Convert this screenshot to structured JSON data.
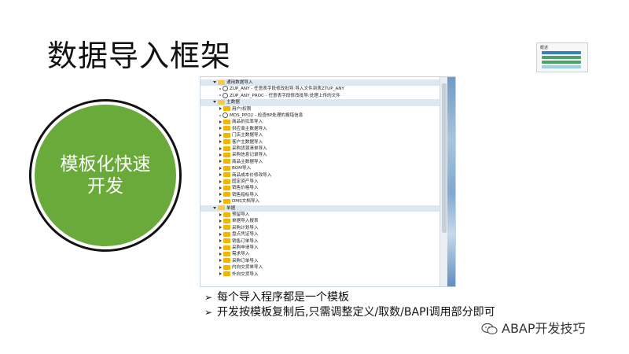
{
  "slide": {
    "title": "数据导入框架",
    "circle_label": "模板化快速开发",
    "bullets": [
      "每个导入程序都是一个模板",
      "开发按模板复制后,只需调整定义/取数/BAPI调用部分即可"
    ],
    "watermark": "ABAP开发技巧",
    "thumbnail_title": "概述"
  },
  "colors": {
    "circle_green": "#6aaa3a",
    "folder": "#f4b400",
    "tree_highlight": "#dde8f3"
  },
  "tree": {
    "rows": [
      {
        "label": "通用数据导入",
        "level": 0,
        "type": "folder-open",
        "expand": "down",
        "highlight": true
      },
      {
        "label": "ZUP_ANY - 任意表字段修改批导:导入文件到表ZTUP_ANY",
        "level": 1,
        "type": "program",
        "expand": "dot"
      },
      {
        "label": "ZUP_ANY_PROC - 任意表字段修改批导:处理上传的文件",
        "level": 1,
        "type": "program",
        "expand": "dot"
      },
      {
        "label": "主数据",
        "level": 0,
        "type": "folder-open",
        "expand": "down",
        "highlight": true
      },
      {
        "label": "用户/权限",
        "level": 1,
        "type": "folder",
        "expand": "right"
      },
      {
        "label": "MDS_PPO2 - 检查BP处理的报错信息",
        "level": 1,
        "type": "program",
        "expand": "dot"
      },
      {
        "label": "商品折扣率导入",
        "level": 1,
        "type": "folder",
        "expand": "right"
      },
      {
        "label": "供应商主数据导入",
        "level": 1,
        "type": "folder",
        "expand": "right"
      },
      {
        "label": "门店主数据导入",
        "level": 1,
        "type": "folder",
        "expand": "right"
      },
      {
        "label": "客户主数据导入",
        "level": 1,
        "type": "folder",
        "expand": "right"
      },
      {
        "label": "采购货源清单导入",
        "level": 1,
        "type": "folder",
        "expand": "right"
      },
      {
        "label": "采购信息记录导入",
        "level": 1,
        "type": "folder",
        "expand": "right"
      },
      {
        "label": "商品主数据导入",
        "level": 1,
        "type": "folder",
        "expand": "right"
      },
      {
        "label": "BOM导入",
        "level": 1,
        "type": "folder",
        "expand": "right"
      },
      {
        "label": "商品成本价修改导入",
        "level": 1,
        "type": "folder",
        "expand": "right"
      },
      {
        "label": "固定资产导入",
        "level": 1,
        "type": "folder",
        "expand": "right"
      },
      {
        "label": "销售价格导入",
        "level": 1,
        "type": "folder",
        "expand": "right"
      },
      {
        "label": "销售指标导入",
        "level": 1,
        "type": "folder",
        "expand": "right"
      },
      {
        "label": "DMS文档导入",
        "level": 1,
        "type": "folder",
        "expand": "right"
      },
      {
        "label": "单据",
        "level": 0,
        "type": "folder-open",
        "expand": "down",
        "highlight": true
      },
      {
        "label": "预留导入",
        "level": 1,
        "type": "folder",
        "expand": "right"
      },
      {
        "label": "单据导入报表",
        "level": 1,
        "type": "folder",
        "expand": "right"
      },
      {
        "label": "采购计划导入",
        "level": 1,
        "type": "folder",
        "expand": "right"
      },
      {
        "label": "盘点凭证导入",
        "level": 1,
        "type": "folder",
        "expand": "right"
      },
      {
        "label": "销售订单导入",
        "level": 1,
        "type": "folder",
        "expand": "right"
      },
      {
        "label": "采购申请导入",
        "level": 1,
        "type": "folder",
        "expand": "right"
      },
      {
        "label": "需求导入",
        "level": 1,
        "type": "folder",
        "expand": "right"
      },
      {
        "label": "采购订单导入",
        "level": 1,
        "type": "folder",
        "expand": "right"
      },
      {
        "label": "内向交货单导入",
        "level": 1,
        "type": "folder",
        "expand": "right"
      },
      {
        "label": "外向交货导入",
        "level": 1,
        "type": "folder",
        "expand": "right"
      }
    ]
  }
}
